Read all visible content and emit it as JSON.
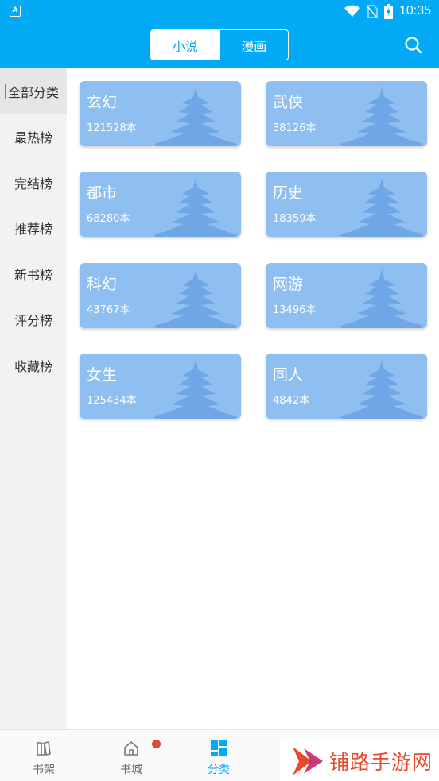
{
  "status_bar": {
    "time": "10:35",
    "app_icon_letter": "A"
  },
  "header": {
    "tabs": [
      {
        "label": "小说",
        "active": true
      },
      {
        "label": "漫画",
        "active": false
      }
    ],
    "search_icon": "search-icon"
  },
  "sidebar": {
    "items": [
      {
        "label": "全部分类",
        "active": true
      },
      {
        "label": "最热榜"
      },
      {
        "label": "完结榜"
      },
      {
        "label": "推荐榜"
      },
      {
        "label": "新书榜"
      },
      {
        "label": "评分榜"
      },
      {
        "label": "收藏榜"
      }
    ]
  },
  "categories": [
    {
      "name": "玄幻",
      "count": "121528本"
    },
    {
      "name": "武侠",
      "count": "38126本"
    },
    {
      "name": "都市",
      "count": "68280本"
    },
    {
      "name": "历史",
      "count": "18359本"
    },
    {
      "name": "科幻",
      "count": "43767本"
    },
    {
      "name": "网游",
      "count": "13496本"
    },
    {
      "name": "女生",
      "count": "125434本"
    },
    {
      "name": "同人",
      "count": "4842本"
    }
  ],
  "bottom_nav": {
    "items": [
      {
        "label": "书架",
        "icon": "bookshelf-icon",
        "badge": false
      },
      {
        "label": "书城",
        "icon": "home-icon",
        "badge": true
      },
      {
        "label": "分类",
        "icon": "category-icon",
        "active": true
      }
    ]
  },
  "watermark": {
    "text": "铺路手游网"
  },
  "colors": {
    "accent": "#02a9f4",
    "card": "#8fbff1",
    "badge": "#e14b3b",
    "watermark": "#e84a2e"
  }
}
